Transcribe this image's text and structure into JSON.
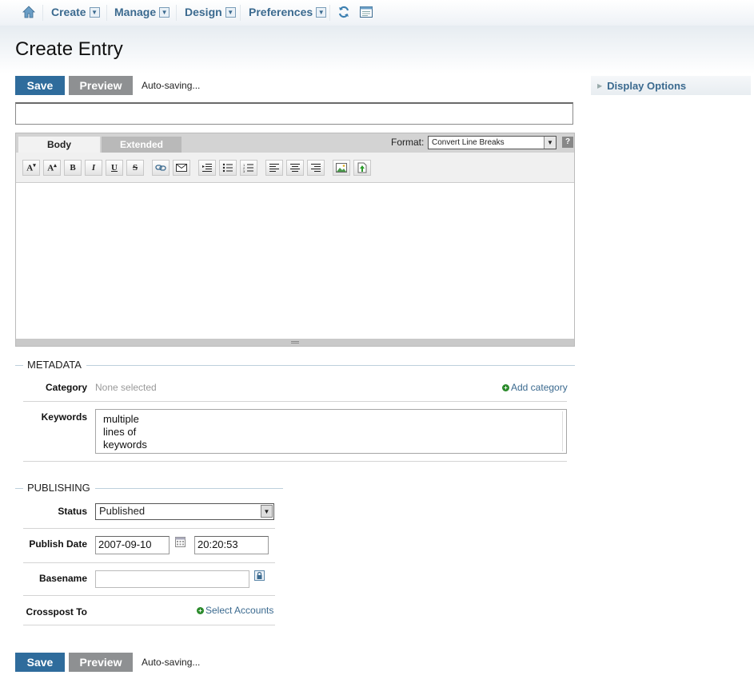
{
  "nav": {
    "items": [
      {
        "label": "Create"
      },
      {
        "label": "Manage"
      },
      {
        "label": "Design"
      },
      {
        "label": "Preferences"
      }
    ]
  },
  "page": {
    "title": "Create Entry"
  },
  "actions": {
    "save_label": "Save",
    "preview_label": "Preview",
    "autosave_text": "Auto-saving..."
  },
  "editor": {
    "tabs": [
      {
        "label": "Body",
        "active": true
      },
      {
        "label": "Extended",
        "active": false
      }
    ],
    "format_label": "Format:",
    "format_value": "Convert Line Breaks",
    "help_label": "?",
    "title_value": "",
    "body_value": ""
  },
  "metadata": {
    "title": "METADATA",
    "category_label": "Category",
    "category_value": "None selected",
    "add_category_label": "Add category",
    "keywords_label": "Keywords",
    "keywords_lines": [
      "multiple",
      "lines of",
      "keywords"
    ]
  },
  "publishing": {
    "title": "PUBLISHING",
    "status_label": "Status",
    "status_value": "Published",
    "publish_date_label": "Publish Date",
    "date_value": "2007-09-10",
    "time_value": "20:20:53",
    "basename_label": "Basename",
    "basename_value": "",
    "crosspost_label": "Crosspost To",
    "select_accounts_label": "Select Accounts"
  },
  "sidebar": {
    "display_options_label": "Display Options"
  },
  "colors": {
    "accent": "#3b6a8f",
    "save": "#2f6c9c",
    "preview": "#8e9092",
    "plus": "#2a8a2a"
  }
}
